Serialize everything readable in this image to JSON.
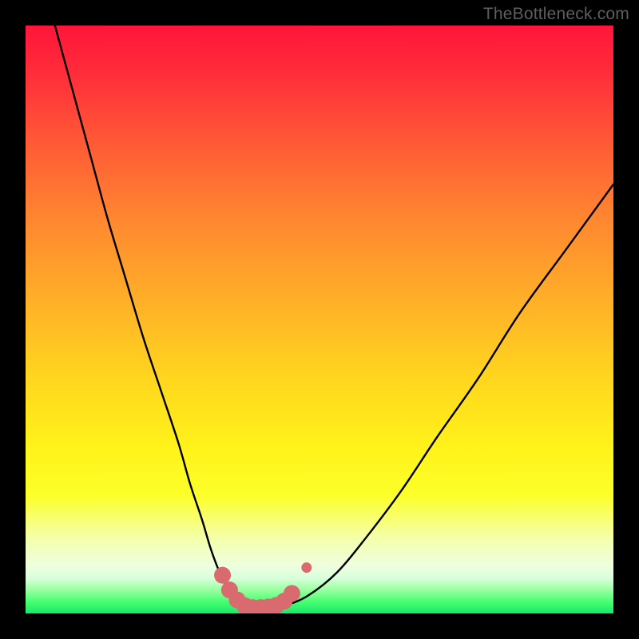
{
  "attribution": "TheBottleneck.com",
  "colors": {
    "frame": "#000000",
    "curve": "#000000",
    "marker_fill": "#d96a6f",
    "marker_stroke": "#d96a6f",
    "gradient_top": "#ff153b",
    "gradient_bottom": "#17e86a"
  },
  "chart_data": {
    "type": "line",
    "title": "",
    "xlabel": "",
    "ylabel": "",
    "xlim": [
      0,
      100
    ],
    "ylim": [
      0,
      100
    ],
    "grid": false,
    "legend": false,
    "series": [
      {
        "name": "bottleneck-curve",
        "x": [
          5,
          8,
          11,
          14,
          17,
          20,
          23,
          26,
          28,
          30,
          31.5,
          33,
          34.5,
          36,
          37.5,
          39,
          41,
          44,
          48,
          53,
          58,
          64,
          70,
          77,
          84,
          92,
          100
        ],
        "y": [
          100,
          89,
          78,
          67,
          57,
          47,
          38,
          29,
          22,
          16,
          11,
          7,
          4,
          2,
          1.2,
          1,
          1,
          1.3,
          3,
          7,
          13,
          21,
          30,
          40,
          51,
          62,
          73
        ]
      }
    ],
    "markers": {
      "name": "bottom-cluster",
      "points": [
        {
          "x": 33.5,
          "y": 6.5
        },
        {
          "x": 34.7,
          "y": 4.0
        },
        {
          "x": 36.0,
          "y": 2.3
        },
        {
          "x": 37.3,
          "y": 1.3
        },
        {
          "x": 38.6,
          "y": 1.0
        },
        {
          "x": 40.0,
          "y": 1.0
        },
        {
          "x": 41.3,
          "y": 1.1
        },
        {
          "x": 42.7,
          "y": 1.4
        },
        {
          "x": 44.0,
          "y": 2.1
        },
        {
          "x": 45.3,
          "y": 3.4
        },
        {
          "x": 47.8,
          "y": 7.8
        }
      ],
      "big_radius": 10.5,
      "small_radius": 6.5,
      "small_index": 10
    }
  }
}
